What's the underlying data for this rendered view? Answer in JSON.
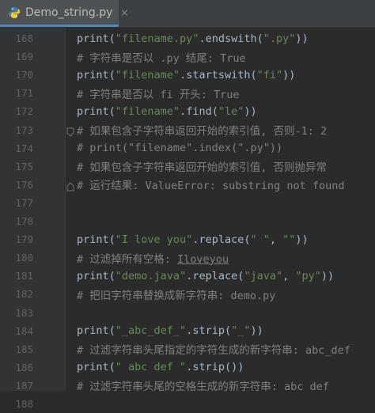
{
  "tab": {
    "title": "Demo_string.py",
    "close": "×"
  },
  "lines": [
    {
      "num": "168",
      "code": "print(\"filename.py\".endswith(\".py\"))"
    },
    {
      "num": "169",
      "code": "# 字符串是否以 .py 结尾: True"
    },
    {
      "num": "170",
      "code": "print(\"filename\".startswith(\"fi\"))"
    },
    {
      "num": "171",
      "code": "# 字符串是否以 fi 开头: True"
    },
    {
      "num": "172",
      "code": "print(\"filename\".find(\"le\"))"
    },
    {
      "num": "173",
      "code": "# 如果包含子字符串返回开始的索引值, 否则-1: 2"
    },
    {
      "num": "174",
      "code": "# print(\"filename\".index(\".py\"))"
    },
    {
      "num": "175",
      "code": "# 如果包含子字符串返回开始的索引值, 否则抛异常"
    },
    {
      "num": "176",
      "code": "# 运行结果: ValueError: substring not found"
    },
    {
      "num": "177",
      "code": ""
    },
    {
      "num": "178",
      "code": ""
    },
    {
      "num": "179",
      "code": "print(\"I love you\".replace(\" \", \"\"))"
    },
    {
      "num": "180",
      "code": "# 过滤掉所有空格: Iloveyou"
    },
    {
      "num": "181",
      "code": "print(\"demo.java\".replace(\"java\", \"py\"))"
    },
    {
      "num": "182",
      "code": "# 把旧字符串替换成新字符串: demo.py"
    },
    {
      "num": "183",
      "code": ""
    },
    {
      "num": "184",
      "code": "print(\"_abc_def_\".strip(\"_\"))"
    },
    {
      "num": "185",
      "code": "# 过滤字符串头尾指定的字符生成的新字符串: abc_def"
    },
    {
      "num": "186",
      "code": "print(\" abc def \".strip())"
    },
    {
      "num": "187",
      "code": "# 过滤字符串头尾的空格生成的新字符串: abc def"
    },
    {
      "num": "188",
      "code": ""
    }
  ],
  "colors": {
    "background": "#2b2b2b",
    "gutter": "#313335",
    "line_number": "#606366",
    "comment": "#808080",
    "string": "#6a8759",
    "text": "#a9b7c6",
    "tab_underline": "#4a88c7"
  },
  "icons": {
    "tab": "python-file-icon",
    "fold": "fold-marker-icon"
  }
}
